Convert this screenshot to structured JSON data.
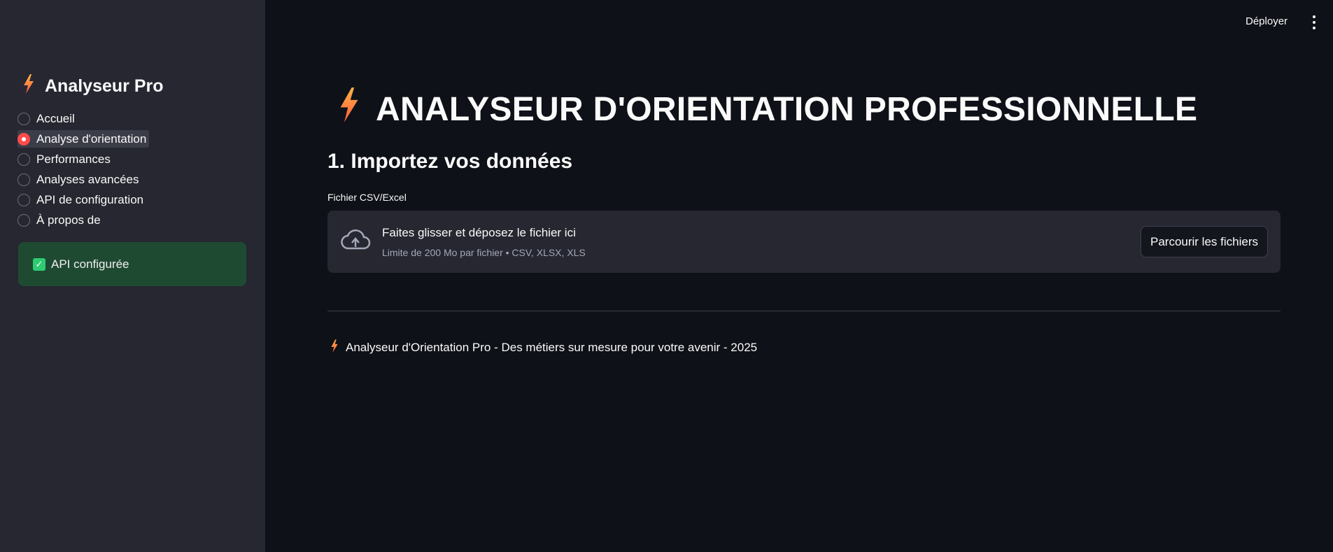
{
  "sidebar": {
    "title": "Analyseur Pro",
    "nav": [
      {
        "label": "Accueil",
        "selected": false
      },
      {
        "label": "Analyse d'orientation",
        "selected": true
      },
      {
        "label": "Performances",
        "selected": false
      },
      {
        "label": "Analyses avancées",
        "selected": false
      },
      {
        "label": "API de configuration",
        "selected": false
      },
      {
        "label": "À propos de",
        "selected": false
      }
    ],
    "status": "API configurée"
  },
  "header": {
    "deploy_label": "Déployer"
  },
  "main": {
    "title": "ANALYSEUR D'ORIENTATION PROFESSIONNELLE",
    "section_heading": "1. Importez vos données",
    "uploader": {
      "label": "Fichier CSV/Excel",
      "drop_text": "Faites glisser et déposez le fichier ici",
      "limit_text": "Limite de 200 Mo par fichier • CSV, XLSX, XLS",
      "browse_label": "Parcourir les fichiers"
    },
    "footer": "Analyseur d'Orientation Pro - Des métiers sur mesure pour votre avenir - 2025"
  },
  "colors": {
    "accent": "#ff4b4b",
    "bolt_top": "#ffb347",
    "bolt_bottom": "#ff5a3c",
    "success_bg": "#1f4a32"
  },
  "icons": {
    "bolt": "lightning-bolt-icon",
    "cloud": "cloud-upload-icon",
    "check": "checkbox-checked-icon",
    "menu": "more-vertical-icon"
  }
}
